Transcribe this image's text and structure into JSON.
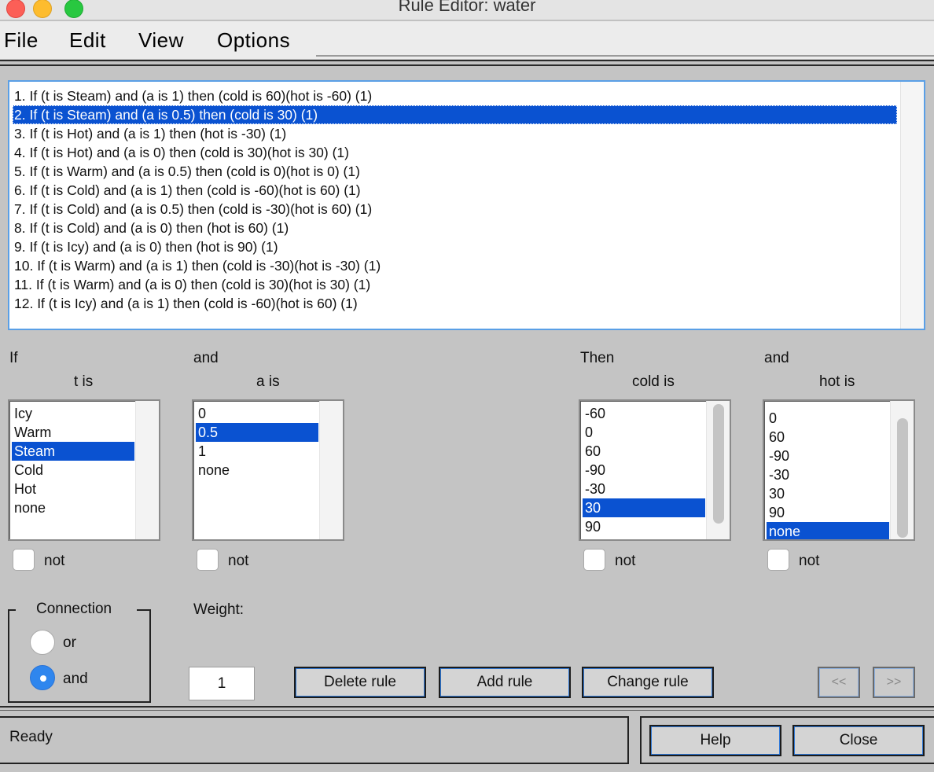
{
  "window": {
    "title": "Rule Editor: water"
  },
  "menu": {
    "items": [
      "File",
      "Edit",
      "View",
      "Options"
    ]
  },
  "rules": [
    "1. If (t is Steam) and (a is 1) then (cold is 60)(hot is -60) (1)",
    "2. If (t is Steam) and (a is 0.5) then (cold is 30) (1)",
    "3. If (t is Hot) and (a is 1) then (hot is -30) (1)",
    "4. If (t is Hot) and (a is 0) then (cold is 30)(hot is 30) (1)",
    "5. If (t is Warm) and (a is 0.5) then (cold is 0)(hot is 0) (1)",
    "6. If (t is Cold) and (a is 1) then (cold is -60)(hot is 60) (1)",
    "7. If (t is Cold) and (a is 0.5) then (cold is -30)(hot is 60) (1)",
    "8. If (t is Cold) and (a is 0) then (hot is 60) (1)",
    "9. If (t is Icy) and (a is 0) then (hot is 90) (1)",
    "10. If (t is Warm) and (a is 1) then (cold is -30)(hot is -30) (1)",
    "11. If (t is Warm) and (a is 0) then (cold is 30)(hot is 30) (1)",
    "12. If (t is Icy) and (a is 1) then (cold is -60)(hot is 60) (1)"
  ],
  "selected_rule": "2. If (t is Steam) and (a is 0.5) then (cold is 30) (1)",
  "antecedent": {
    "if_label": "If",
    "and_label": "and",
    "t": {
      "label": "t is",
      "options": [
        "Icy",
        "Warm",
        "Steam",
        "Cold",
        "Hot",
        "none"
      ],
      "selected": "Steam",
      "not_label": "not"
    },
    "a": {
      "label": "a is",
      "options": [
        "0",
        "0.5",
        "1",
        "none"
      ],
      "selected": "0.5",
      "not_label": "not"
    }
  },
  "consequent": {
    "then_label": "Then",
    "and_label": "and",
    "cold": {
      "label": "cold is",
      "options": [
        "-60",
        "0",
        "60",
        "-90",
        "-30",
        "30",
        "90"
      ],
      "selected": "30",
      "not_label": "not"
    },
    "hot": {
      "label": "hot is",
      "options": [
        "0",
        "60",
        "-90",
        "-30",
        "30",
        "90",
        "none"
      ],
      "selected": "none",
      "not_label": "not"
    }
  },
  "connection": {
    "title": "Connection",
    "options": [
      "or",
      "and"
    ],
    "selected": "and"
  },
  "weight": {
    "label": "Weight:",
    "value": "1"
  },
  "buttons": {
    "delete": "Delete rule",
    "add": "Add rule",
    "change": "Change rule",
    "prev": "<<",
    "next": ">>",
    "help": "Help",
    "close": "Close"
  },
  "status": {
    "text": "Ready"
  },
  "colors": {
    "selection": "#0a52d1",
    "list_border": "#5a9fe6",
    "radio_on": "#2f86ee",
    "background": "#c4c4c4"
  }
}
